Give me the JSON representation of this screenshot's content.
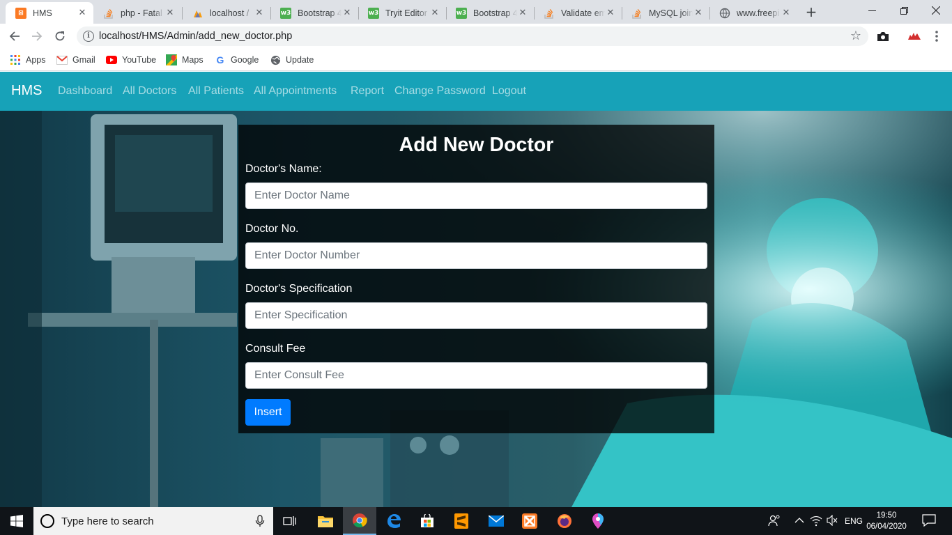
{
  "browser": {
    "tabs": [
      {
        "title": "HMS",
        "icon": "xampp-icon",
        "active": true
      },
      {
        "title": "php - Fatal",
        "icon": "stackoverflow-icon"
      },
      {
        "title": "localhost /",
        "icon": "phpmyadmin-icon"
      },
      {
        "title": "Bootstrap 4",
        "icon": "w3schools-icon"
      },
      {
        "title": "Tryit Editor",
        "icon": "w3schools-icon"
      },
      {
        "title": "Bootstrap 4",
        "icon": "w3schools-icon"
      },
      {
        "title": "Validate em",
        "icon": "stackoverflow-icon"
      },
      {
        "title": "MySQL join",
        "icon": "stackoverflow-icon"
      },
      {
        "title": "www.freepi",
        "icon": "globe-icon"
      }
    ],
    "close_glyph": "✕",
    "new_tab_glyph": "+",
    "url": "localhost/HMS/Admin/add_new_doctor.php",
    "bookmarks": [
      {
        "label": "Apps",
        "icon": "apps-grid-icon"
      },
      {
        "label": "Gmail",
        "icon": "gmail-icon"
      },
      {
        "label": "YouTube",
        "icon": "youtube-icon"
      },
      {
        "label": "Maps",
        "icon": "maps-icon"
      },
      {
        "label": "Google",
        "icon": "google-icon"
      },
      {
        "label": "Update",
        "icon": "update-icon"
      }
    ]
  },
  "navbar": {
    "brand": "HMS",
    "links": [
      "Dashboard",
      "All Doctors",
      "All Patients",
      "All Appointments",
      "Report",
      "Change Password",
      "Logout"
    ],
    "color": "#17a2b8"
  },
  "form": {
    "title": "Add New Doctor",
    "fields": [
      {
        "label": "Doctor's Name:",
        "placeholder": "Enter Doctor Name"
      },
      {
        "label": "Doctor No.",
        "placeholder": "Enter Doctor Number"
      },
      {
        "label": "Doctor's Specification",
        "placeholder": "Enter Specification"
      },
      {
        "label": "Consult Fee",
        "placeholder": "Enter Consult Fee"
      }
    ],
    "submit_label": "Insert",
    "submit_color": "#007bff"
  },
  "taskbar": {
    "search_placeholder": "Type here to search",
    "language": "ENG",
    "time": "19:50",
    "date": "06/04/2020"
  }
}
